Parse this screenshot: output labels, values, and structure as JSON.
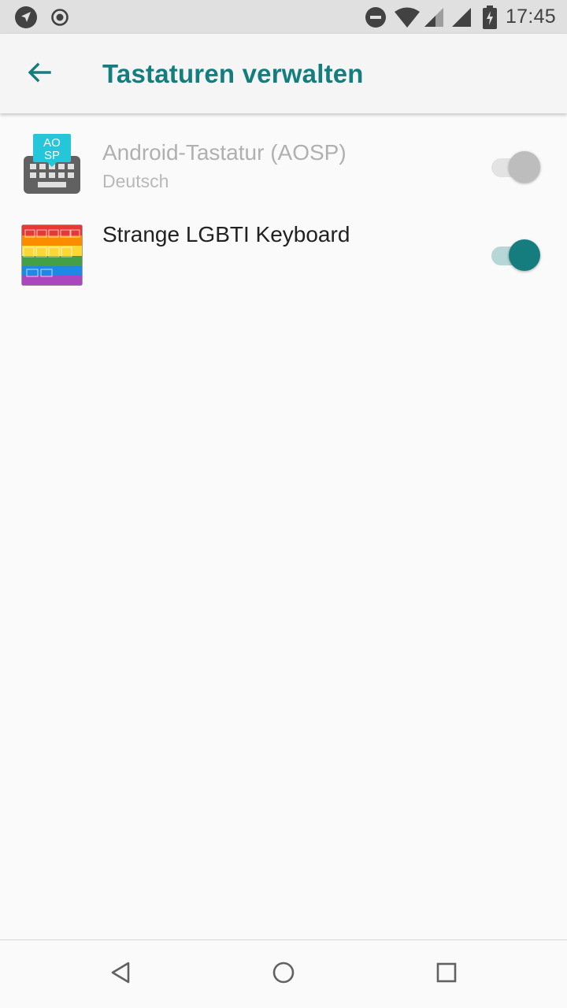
{
  "status_bar": {
    "time": "17:45",
    "left_icons": [
      "navigation-icon",
      "record-icon"
    ],
    "right_icons": [
      "do-not-disturb-icon",
      "wifi-icon",
      "signal-icon",
      "signal-icon",
      "battery-charging-icon"
    ]
  },
  "app_bar": {
    "title": "Tastaturen verwalten",
    "back_icon": "arrow-back-icon",
    "accent_color": "#167d7f"
  },
  "keyboards": [
    {
      "name": "Android-Tastatur (AOSP)",
      "subtitle": "Deutsch",
      "enabled": false,
      "disabled_appearance": true,
      "icon": "aosp-keyboard-icon",
      "icon_text": [
        "AO",
        "SP"
      ]
    },
    {
      "name": "Strange LGBTI Keyboard",
      "subtitle": "",
      "enabled": true,
      "disabled_appearance": false,
      "icon": "rainbow-keyboard-icon"
    }
  ],
  "nav_bar": {
    "buttons": [
      "back-triangle-icon",
      "home-circle-icon",
      "recents-square-icon"
    ]
  }
}
